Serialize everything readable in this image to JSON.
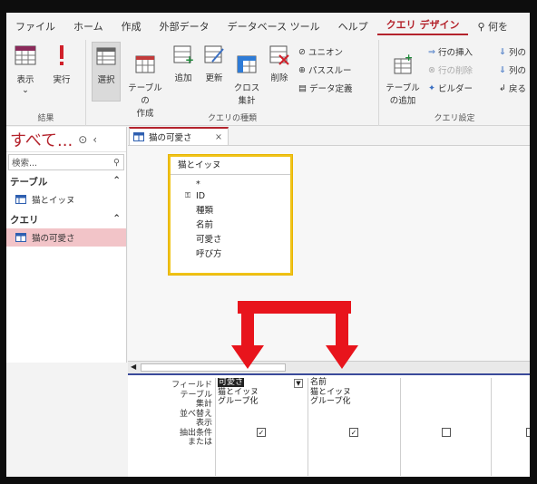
{
  "ribbon_tabs": [
    "ファイル",
    "ホーム",
    "作成",
    "外部データ",
    "データベース ツール",
    "ヘルプ",
    "クエリ デザイン"
  ],
  "tell_me": "何を",
  "groups": {
    "results": {
      "label": "結果",
      "view": "表示",
      "run": "実行"
    },
    "query_type": {
      "label": "クエリの種類",
      "select": "選択",
      "make_table": "テーブルの\n作成",
      "append": "追加",
      "update": "更新",
      "crosstab": "クロス\n集計",
      "delete": "削除",
      "union": "ユニオン",
      "passthrough": "パススルー",
      "data_definition": "データ定義"
    },
    "query_setup": {
      "label": "クエリ設定",
      "add_table": "テーブル\nの追加",
      "insert_rows": "行の挿入",
      "delete_rows": "行の削除",
      "builder": "ビルダー",
      "col1": "列の",
      "col2": "列の",
      "return": "戻る"
    }
  },
  "nav": {
    "title": "すべて...",
    "search_placeholder": "検索...",
    "sections": [
      {
        "label": "テーブル",
        "items": [
          "猫とイッヌ"
        ]
      },
      {
        "label": "クエリ",
        "items": [
          "猫の可愛さ"
        ]
      }
    ]
  },
  "document_tab": "猫の可愛さ",
  "table_box": {
    "title": "猫とイッヌ",
    "fields": [
      "*",
      "ID",
      "種類",
      "名前",
      "可愛さ",
      "呼び方"
    ]
  },
  "qbe": {
    "row_labels": [
      "フィールド",
      "テーブル",
      "集計",
      "並べ替え",
      "表示",
      "抽出条件",
      "または"
    ],
    "columns": [
      {
        "field": "可愛さ",
        "table": "猫とイッヌ",
        "total": "グループ化",
        "show": true
      },
      {
        "field": "名前",
        "table": "猫とイッヌ",
        "total": "グループ化",
        "show": true
      },
      {
        "field": "",
        "table": "",
        "total": "",
        "show": false
      },
      {
        "field": "",
        "table": "",
        "total": "",
        "show": false
      }
    ]
  },
  "colors": {
    "access_red": "#b4232c",
    "annotation_red": "#e8141c",
    "table_highlight": "#f0c419",
    "selected_nav": "#f2c4c8"
  }
}
